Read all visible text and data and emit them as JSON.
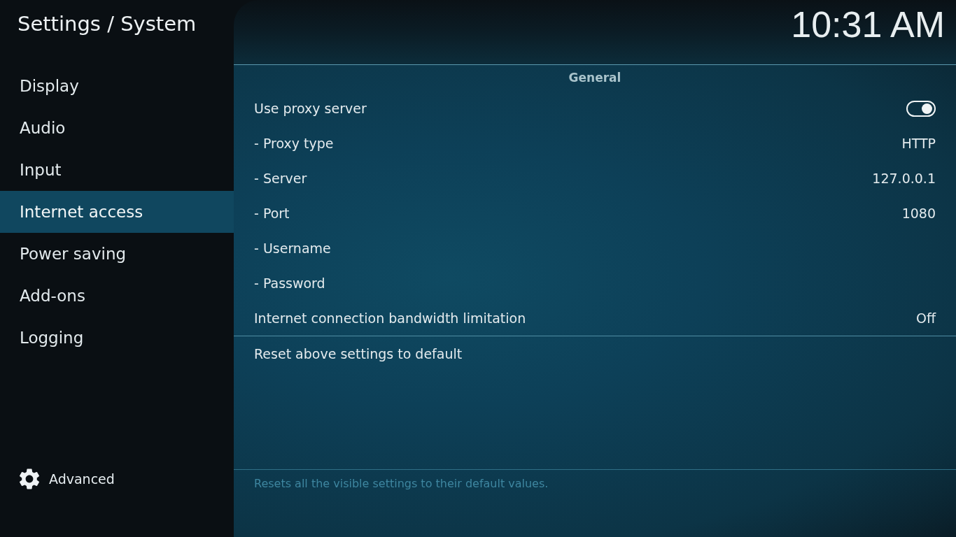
{
  "header": {
    "title": "Settings / System",
    "clock": "10:31 AM"
  },
  "sidebar": {
    "items": [
      {
        "label": "Display",
        "selected": false
      },
      {
        "label": "Audio",
        "selected": false
      },
      {
        "label": "Input",
        "selected": false
      },
      {
        "label": "Internet access",
        "selected": true
      },
      {
        "label": "Power saving",
        "selected": false
      },
      {
        "label": "Add-ons",
        "selected": false
      },
      {
        "label": "Logging",
        "selected": false
      }
    ],
    "advanced": {
      "label": "Advanced"
    }
  },
  "settings": {
    "section": "General",
    "rows": [
      {
        "kind": "toggle",
        "label": "Use proxy server",
        "on": true
      },
      {
        "kind": "value",
        "label": "- Proxy type",
        "value": "HTTP"
      },
      {
        "kind": "value",
        "label": "- Server",
        "value": "127.0.0.1"
      },
      {
        "kind": "value",
        "label": "- Port",
        "value": "1080"
      },
      {
        "kind": "plain",
        "label": "- Username"
      },
      {
        "kind": "plain",
        "label": "- Password"
      },
      {
        "kind": "value",
        "label": "Internet connection bandwidth limitation",
        "value": "Off"
      }
    ],
    "reset": {
      "label": "Reset above settings to default"
    }
  },
  "description": "Resets all the visible settings to their default values."
}
